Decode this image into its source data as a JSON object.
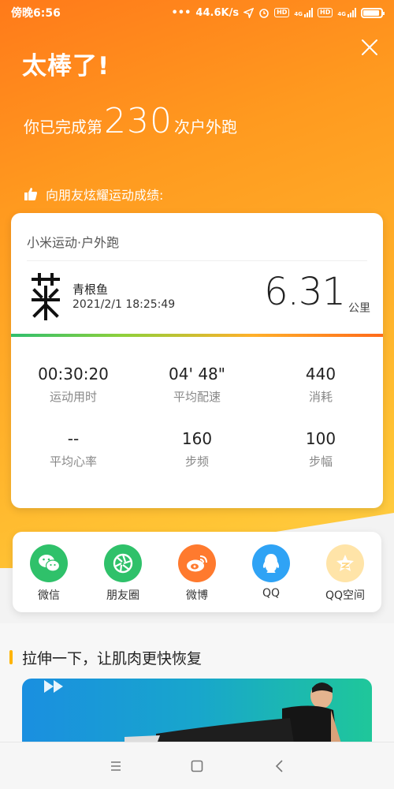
{
  "status": {
    "time": "傍晚6:56",
    "speed": "44.6K/s",
    "hd1": "HD",
    "hd2": "HD",
    "net1": "4G",
    "net2": "4G"
  },
  "header": {
    "headline": "太棒了!",
    "count_prefix": "你已完成第",
    "count": "230",
    "count_suffix": "次户外跑",
    "share_tip": "向朋友炫耀运动成绩:"
  },
  "card": {
    "title": "小米运动·户外跑",
    "username": "青根鱼",
    "datetime": "2021/2/1 18:25:49",
    "distance": "6.31",
    "distance_unit": "公里",
    "stats": [
      {
        "value": "00:30:20",
        "label": "运动用时"
      },
      {
        "value": "04' 48\"",
        "label": "平均配速"
      },
      {
        "value": "440",
        "label": "消耗"
      },
      {
        "value": "--",
        "label": "平均心率"
      },
      {
        "value": "160",
        "label": "步频"
      },
      {
        "value": "100",
        "label": "步幅"
      }
    ]
  },
  "share": {
    "items": [
      {
        "label": "微信",
        "icon": "wechat-icon",
        "color": "#2fc16a"
      },
      {
        "label": "朋友圈",
        "icon": "moments-icon",
        "color": "#2fc16a"
      },
      {
        "label": "微博",
        "icon": "weibo-icon",
        "color": "#ff7a2e"
      },
      {
        "label": "QQ",
        "icon": "qq-icon",
        "color": "#2fa3f5"
      },
      {
        "label": "QQ空间",
        "icon": "qzone-icon",
        "color": "#ffe4a8"
      }
    ]
  },
  "section": {
    "title": "拉伸一下，让肌肉更快恢复"
  },
  "colors": {
    "orange": "#ff8a1f",
    "yellow": "#ffc535",
    "accent_bar": "#ffb400"
  }
}
